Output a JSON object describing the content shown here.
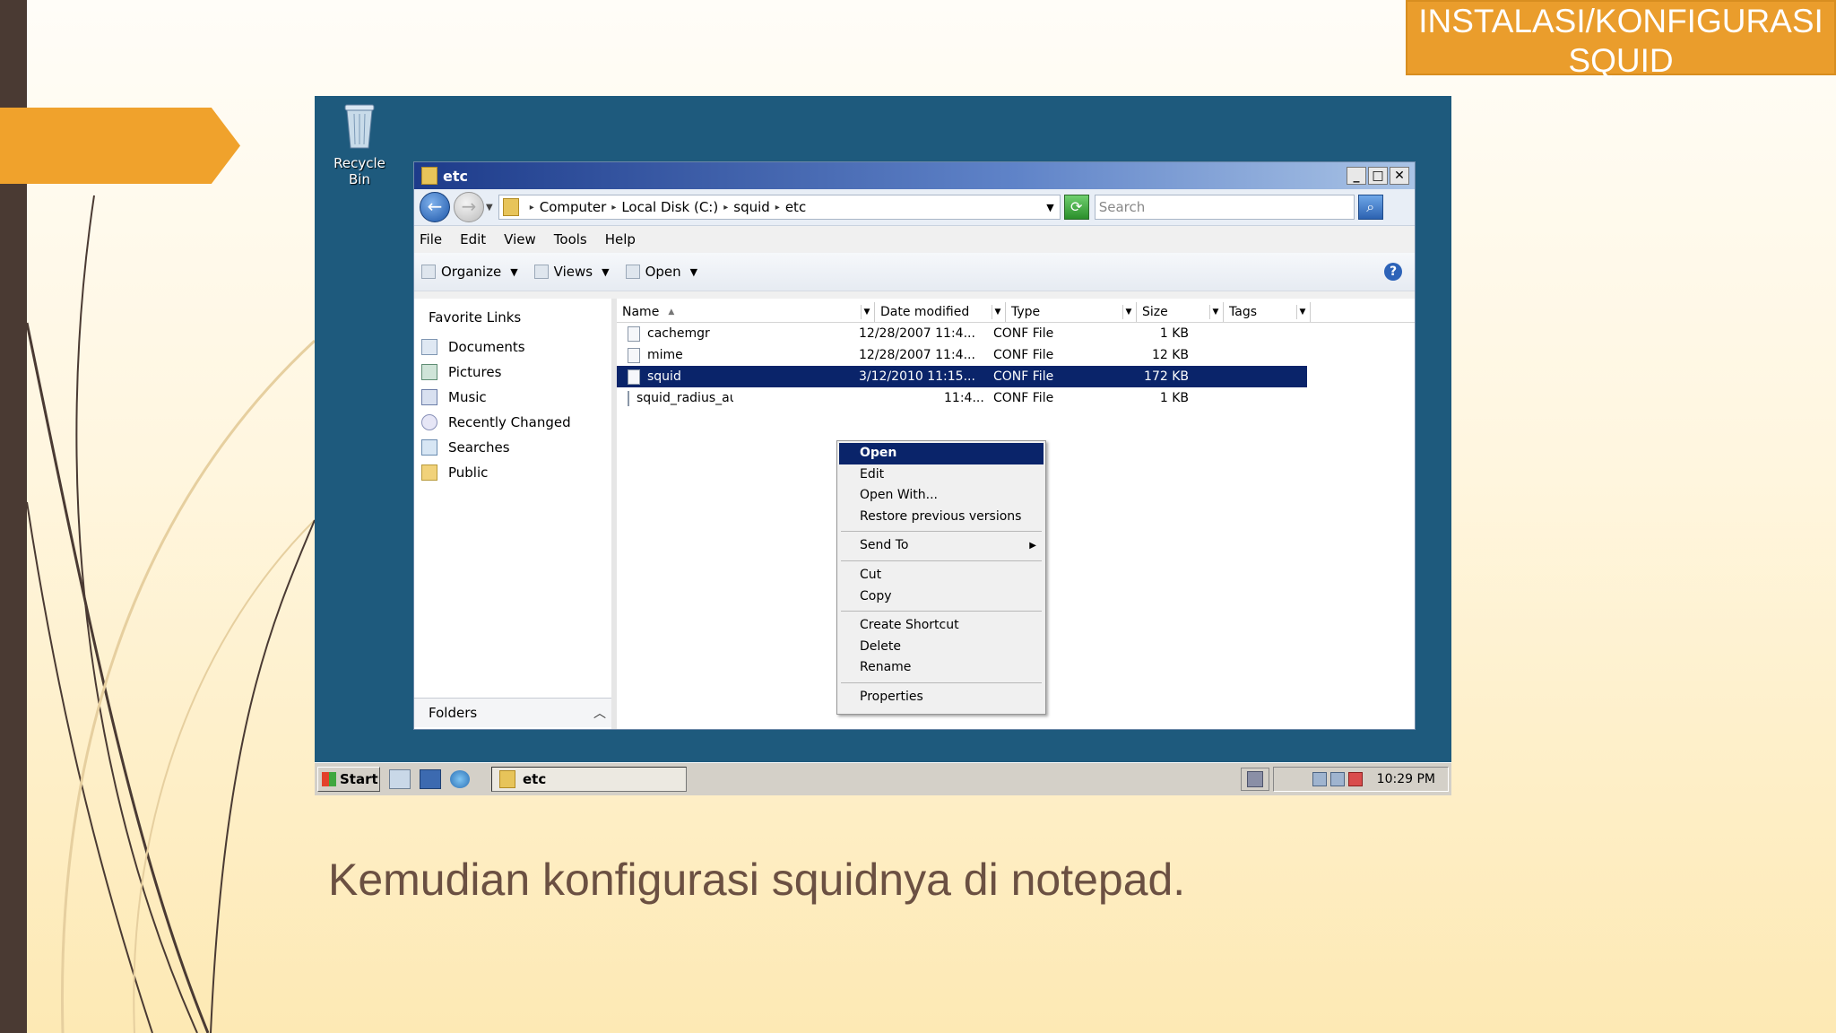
{
  "slide": {
    "title_line1": "INSTALASI/KONFIGURASI",
    "title_line2": "SQUID",
    "caption": "Kemudian konfigurasi squidnya di notepad.",
    "accent_color": "#f0a22c",
    "strip_color": "#4a3a33"
  },
  "desktop": {
    "recycle_bin_label": "Recycle Bin"
  },
  "window": {
    "title": "etc",
    "breadcrumb": [
      "Computer",
      "Local Disk (C:)",
      "squid",
      "etc"
    ],
    "search_placeholder": "Search",
    "menu": [
      "File",
      "Edit",
      "View",
      "Tools",
      "Help"
    ],
    "toolbar": {
      "organize": "Organize",
      "views": "Views",
      "open": "Open"
    },
    "favorite_links_title": "Favorite Links",
    "favorite_links": [
      "Documents",
      "Pictures",
      "Music",
      "Recently Changed",
      "Searches",
      "Public"
    ],
    "folders_label": "Folders",
    "columns": [
      "Name",
      "Date modified",
      "Type",
      "Size",
      "Tags"
    ],
    "files": [
      {
        "name": "cachemgr",
        "date": "12/28/2007 11:4...",
        "type": "CONF File",
        "size": "1 KB"
      },
      {
        "name": "mime",
        "date": "12/28/2007 11:4...",
        "type": "CONF File",
        "size": "12 KB"
      },
      {
        "name": "squid",
        "date": "3/12/2010 11:15...",
        "type": "CONF File",
        "size": "172 KB"
      },
      {
        "name": "squid_radius_au",
        "date": "11:4...",
        "type": "CONF File",
        "size": "1 KB"
      }
    ]
  },
  "context_menu": {
    "group1": [
      "Open",
      "Edit",
      "Open With...",
      "Restore previous versions"
    ],
    "group2": [
      "Send To"
    ],
    "group3": [
      "Cut",
      "Copy"
    ],
    "group4": [
      "Create Shortcut",
      "Delete",
      "Rename"
    ],
    "group5": [
      "Properties"
    ]
  },
  "taskbar": {
    "start": "Start",
    "task": "etc",
    "clock": "10:29 PM"
  }
}
